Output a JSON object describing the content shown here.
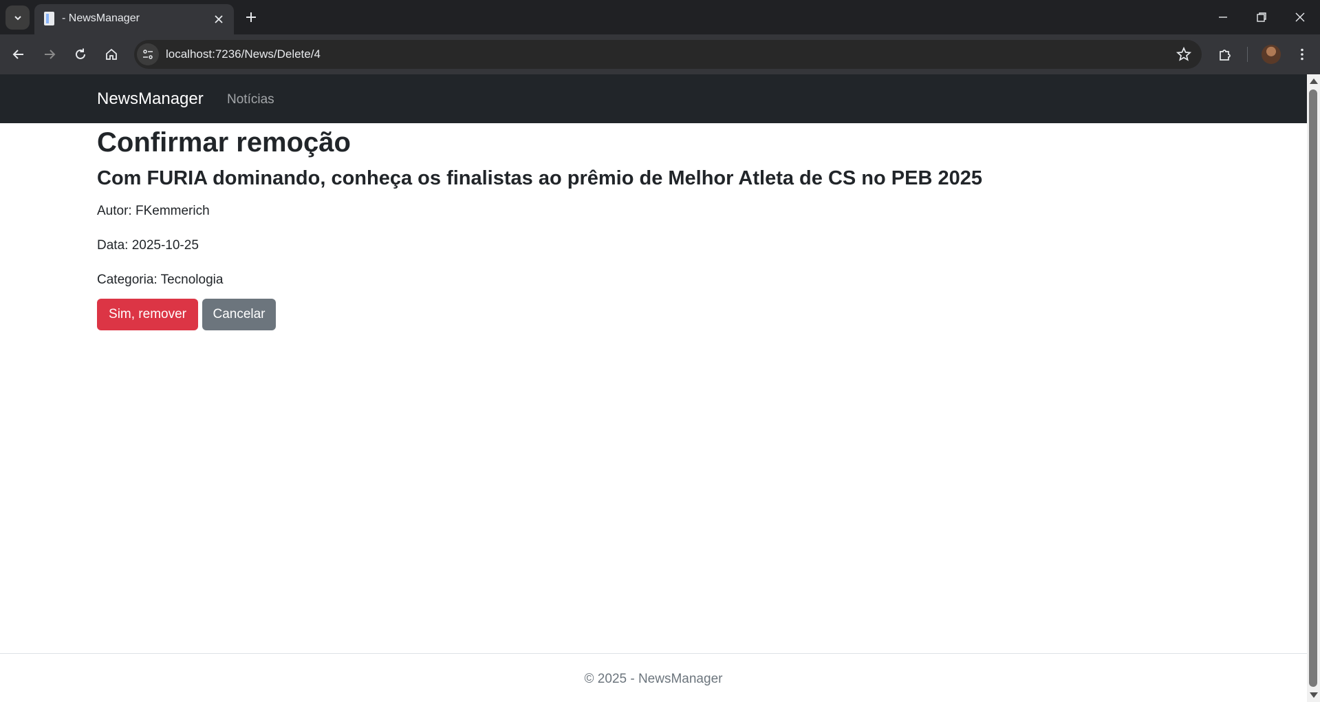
{
  "browser": {
    "tab_title": "- NewsManager",
    "url": "localhost:7236/News/Delete/4"
  },
  "app": {
    "brand": "NewsManager",
    "nav_links": [
      "Notícias"
    ]
  },
  "page": {
    "heading": "Confirmar remoção",
    "news_title": "Com FURIA dominando, conheça os finalistas ao prêmio de Melhor Atleta de CS no PEB 2025",
    "author_line": "Autor: FKemmerich",
    "date_line": "Data: 2025-10-25",
    "category_line": "Categoria: Tecnologia",
    "confirm_button": "Sim, remover",
    "cancel_button": "Cancelar"
  },
  "footer": {
    "text": "© 2025 - NewsManager"
  },
  "colors": {
    "navbar": "#212529",
    "danger": "#dc3545",
    "secondary": "#6c757d",
    "chrome_dark": "#202124",
    "chrome_toolbar": "#35363a"
  },
  "icons": {
    "tab_search": "chevron-down-icon",
    "tab_close": "close-icon",
    "new_tab": "plus-icon",
    "back": "arrow-left-icon",
    "forward": "arrow-right-icon",
    "reload": "reload-icon",
    "home": "home-icon",
    "site_info": "site-settings-icon",
    "bookmark": "star-icon",
    "extensions": "puzzle-icon",
    "menu": "kebab-menu-icon"
  }
}
